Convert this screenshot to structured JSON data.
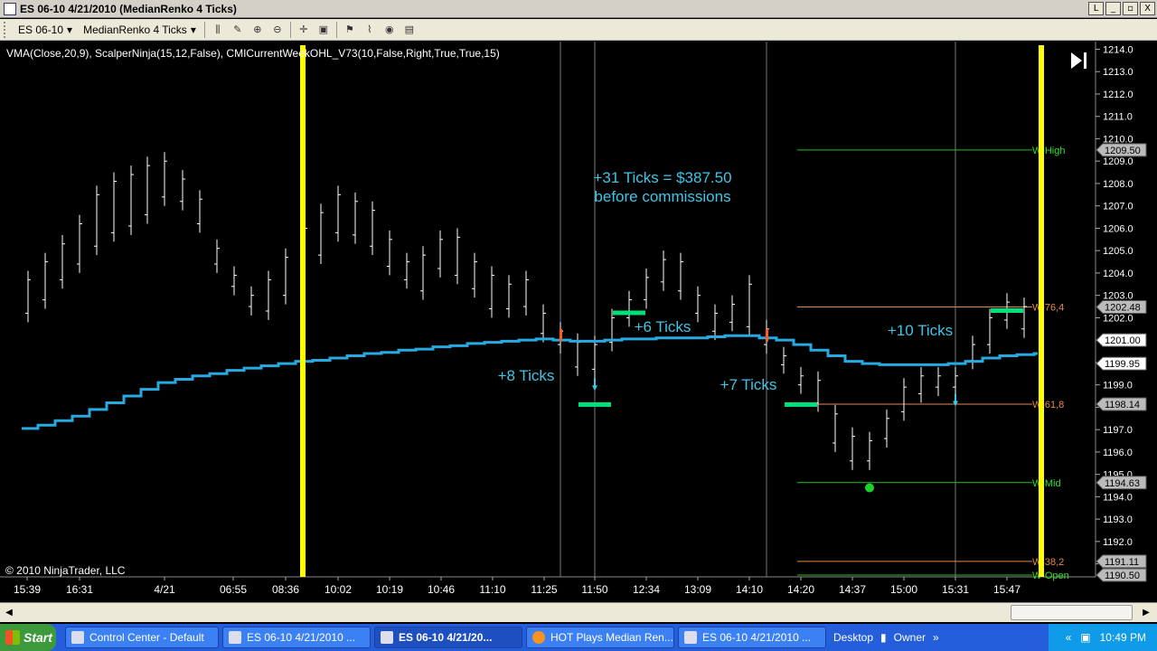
{
  "window": {
    "title": "ES 06-10  4/21/2010 (MedianRenko 4 Ticks)",
    "buttons": [
      "L",
      "_",
      "▫",
      "X"
    ]
  },
  "toolbar": {
    "instrument": "ES 06-10",
    "period": "MedianRenko 4 Ticks"
  },
  "chart": {
    "indicator_label": "VMA(Close,20,9), ScalperNinja(15,12,False), CMICurrentWeekOHL_V73(10,False,Right,True,True,15)",
    "copyright": "© 2010 NinjaTrader, LLC",
    "x_labels": [
      "15:39",
      "16:31",
      "4/21",
      "06:55",
      "08:36",
      "10:02",
      "10:19",
      "10:46",
      "11:10",
      "11:25",
      "11:50",
      "12:34",
      "13:09",
      "14:10",
      "14:20",
      "14:37",
      "15:00",
      "15:31",
      "15:47"
    ],
    "y_ticks": [
      1214,
      1213,
      1212,
      1211,
      1210,
      1209,
      1208,
      1207,
      1206,
      1205,
      1204,
      1203,
      1202,
      1201,
      1200,
      1199,
      1198,
      1197,
      1196,
      1195,
      1194,
      1193,
      1192,
      1191
    ],
    "y_range": [
      1190.5,
      1214.1
    ],
    "price_flags": [
      {
        "label": "1209.50",
        "value": 1209.5
      },
      {
        "label": "1202.48",
        "value": 1202.48
      },
      {
        "label": "1201.00",
        "value": 1201.0
      },
      {
        "label": "1199.95",
        "value": 1199.95
      },
      {
        "label": "1198.14",
        "value": 1198.14
      },
      {
        "label": "1194.63",
        "value": 1194.63
      },
      {
        "label": "1191.11",
        "value": 1191.11
      },
      {
        "label": "1190.50",
        "value": 1190.5
      }
    ],
    "levels": [
      {
        "label": "W-High",
        "value": 1209.5,
        "color": "#22c222"
      },
      {
        "label": "W-76,4",
        "value": 1202.48,
        "color": "#e08a50"
      },
      {
        "label": "W-61,8",
        "value": 1198.14,
        "color": "#e08a50"
      },
      {
        "label": "W-Mid",
        "value": 1194.63,
        "color": "#22c222"
      },
      {
        "label": "W-38,2",
        "value": 1191.11,
        "color": "#e08a50"
      },
      {
        "label": "W-Open",
        "value": 1190.5,
        "color": "#22c222"
      }
    ],
    "annotations": [
      {
        "text": "+31 Ticks = $387.50"
      },
      {
        "text": "before commissions"
      },
      {
        "text": "+8 Ticks"
      },
      {
        "text": "+6 Ticks"
      },
      {
        "text": "+7 Ticks"
      },
      {
        "text": "+10 Ticks"
      }
    ],
    "colors": {
      "vma": "#27a9e1",
      "session": "#ffff00",
      "signal": "#00e07a",
      "annotation": "#3ec6e8"
    }
  },
  "taskbar": {
    "start": "Start",
    "tasks": [
      {
        "label": "Control Center - Default",
        "active": false
      },
      {
        "label": "ES 06-10  4/21/2010 ...",
        "active": false
      },
      {
        "label": "ES 06-10  4/21/20...",
        "active": true
      },
      {
        "label": "HOT Plays Median Ren...",
        "active": false
      },
      {
        "label": "ES 06-10  4/21/2010 ...",
        "active": false
      }
    ],
    "desktop": "Desktop",
    "owner": "Owner",
    "clock": "10:49 PM"
  }
}
